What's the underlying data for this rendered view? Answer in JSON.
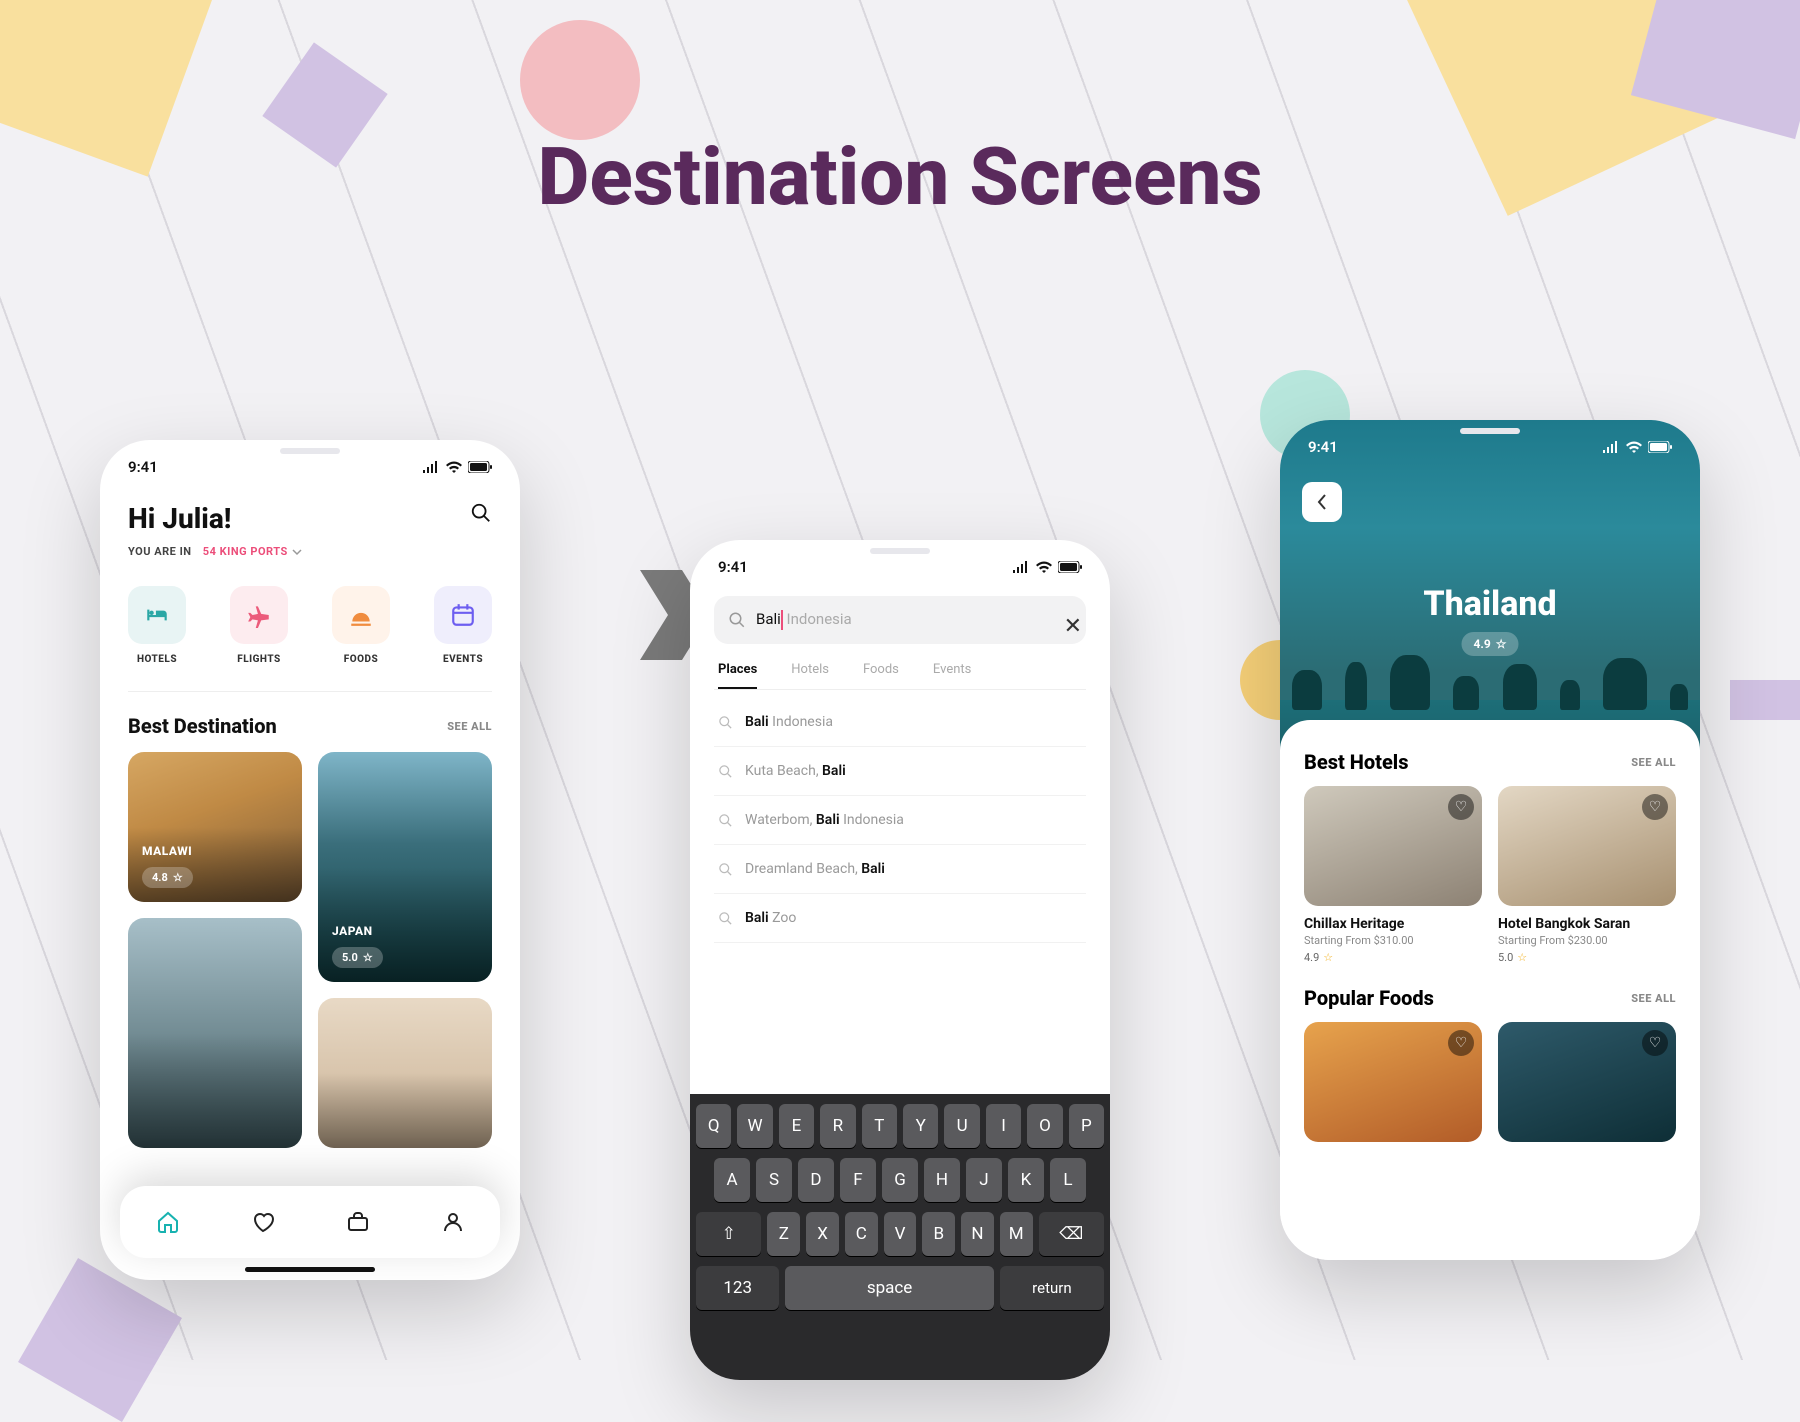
{
  "page_title": "Destination Screens",
  "status": {
    "time": "9:41"
  },
  "screen1": {
    "greeting": "Hi Julia!",
    "location_prefix": "YOU ARE IN",
    "location": "54 KING PORTS",
    "categories": [
      {
        "label": "HOTELS",
        "color_bg": "#e8f4f4",
        "color_ic": "#2aa7a5",
        "icon": "bed"
      },
      {
        "label": "FLIGHTS",
        "color_bg": "#fdecef",
        "color_ic": "#ec5b7b",
        "icon": "plane"
      },
      {
        "label": "FOODS",
        "color_bg": "#fff3ea",
        "color_ic": "#f08c3f",
        "icon": "food"
      },
      {
        "label": "EVENTS",
        "color_bg": "#efeefc",
        "color_ic": "#6d5ef0",
        "icon": "calendar"
      }
    ],
    "section_title": "Best Destination",
    "see_all": "SEE ALL",
    "destinations": {
      "col1": [
        {
          "name": "MALAWI",
          "rating": "4.8",
          "size": "short",
          "bg": "bg-malawi"
        },
        {
          "name": "",
          "rating": "",
          "size": "tall",
          "bg": "bg-shoes"
        }
      ],
      "col2": [
        {
          "name": "JAPAN",
          "rating": "5.0",
          "size": "tall",
          "bg": "bg-japan"
        },
        {
          "name": "",
          "rating": "",
          "size": "short",
          "bg": "bg-misc"
        }
      ]
    },
    "nav": [
      "home",
      "heart",
      "briefcase",
      "user"
    ]
  },
  "screen2": {
    "search_query": "Bali",
    "search_placeholder": " Indonesia",
    "tabs": [
      "Places",
      "Hotels",
      "Foods",
      "Events"
    ],
    "active_tab": 0,
    "results": [
      {
        "pre": "",
        "bold": "Bali",
        "post": " Indonesia"
      },
      {
        "pre": "Kuta Beach, ",
        "bold": "Bali",
        "post": ""
      },
      {
        "pre": "Waterbom, ",
        "bold": "Bali",
        "post": " Indonesia"
      },
      {
        "pre": "Dreamland Beach, ",
        "bold": "Bali",
        "post": ""
      },
      {
        "pre": "",
        "bold": "Bali",
        "post": " Zoo"
      }
    ],
    "keyboard": {
      "r1": [
        "Q",
        "W",
        "E",
        "R",
        "T",
        "Y",
        "U",
        "I",
        "O",
        "P"
      ],
      "r2": [
        "A",
        "S",
        "D",
        "F",
        "G",
        "H",
        "J",
        "K",
        "L"
      ],
      "r3": [
        "Z",
        "X",
        "C",
        "V",
        "B",
        "N",
        "M"
      ],
      "num": "123",
      "space": "space",
      "ret": "return"
    }
  },
  "screen3": {
    "title": "Thailand",
    "rating": "4.9",
    "hotels_title": "Best Hotels",
    "see_all": "SEE ALL",
    "hotels": [
      {
        "name": "Chillax Heritage",
        "price_label": "Starting From $310.00",
        "rating": "4.9",
        "bg": "bg-hotel1"
      },
      {
        "name": "Hotel Bangkok Saran",
        "price_label": "Starting From $230.00",
        "rating": "5.0",
        "bg": "bg-hotel2"
      }
    ],
    "foods_title": "Popular Foods",
    "foods": [
      {
        "bg": "bg-food1"
      },
      {
        "bg": "bg-food2"
      }
    ]
  }
}
